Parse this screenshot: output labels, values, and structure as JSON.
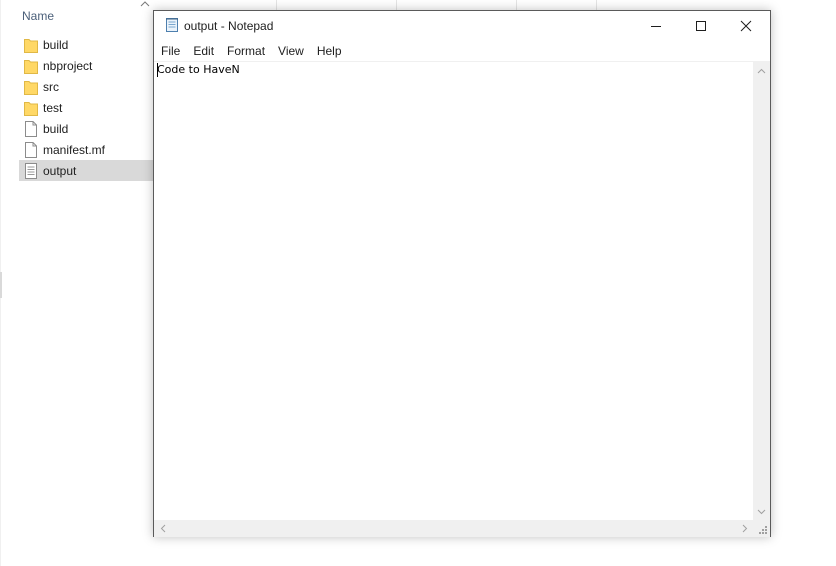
{
  "explorer": {
    "column_name": "Name",
    "files": [
      {
        "name": "build",
        "icon": "folder-icon"
      },
      {
        "name": "nbproject",
        "icon": "folder-icon"
      },
      {
        "name": "src",
        "icon": "folder-icon"
      },
      {
        "name": "test",
        "icon": "folder-icon"
      },
      {
        "name": "build",
        "icon": "file-icon"
      },
      {
        "name": "manifest.mf",
        "icon": "file-icon"
      },
      {
        "name": "output",
        "icon": "text-file-icon",
        "selected": true
      }
    ]
  },
  "notepad": {
    "title": "output - Notepad",
    "menu": [
      "File",
      "Edit",
      "Format",
      "View",
      "Help"
    ],
    "content": "Code to HaveN",
    "window_buttons": [
      "minimize-icon",
      "maximize-icon",
      "close-icon"
    ]
  },
  "colors": {
    "selection": "#d9d9d9",
    "folder": "#ffd866",
    "header_text": "#4c607a",
    "scrollbar": "#f0f0f0"
  }
}
